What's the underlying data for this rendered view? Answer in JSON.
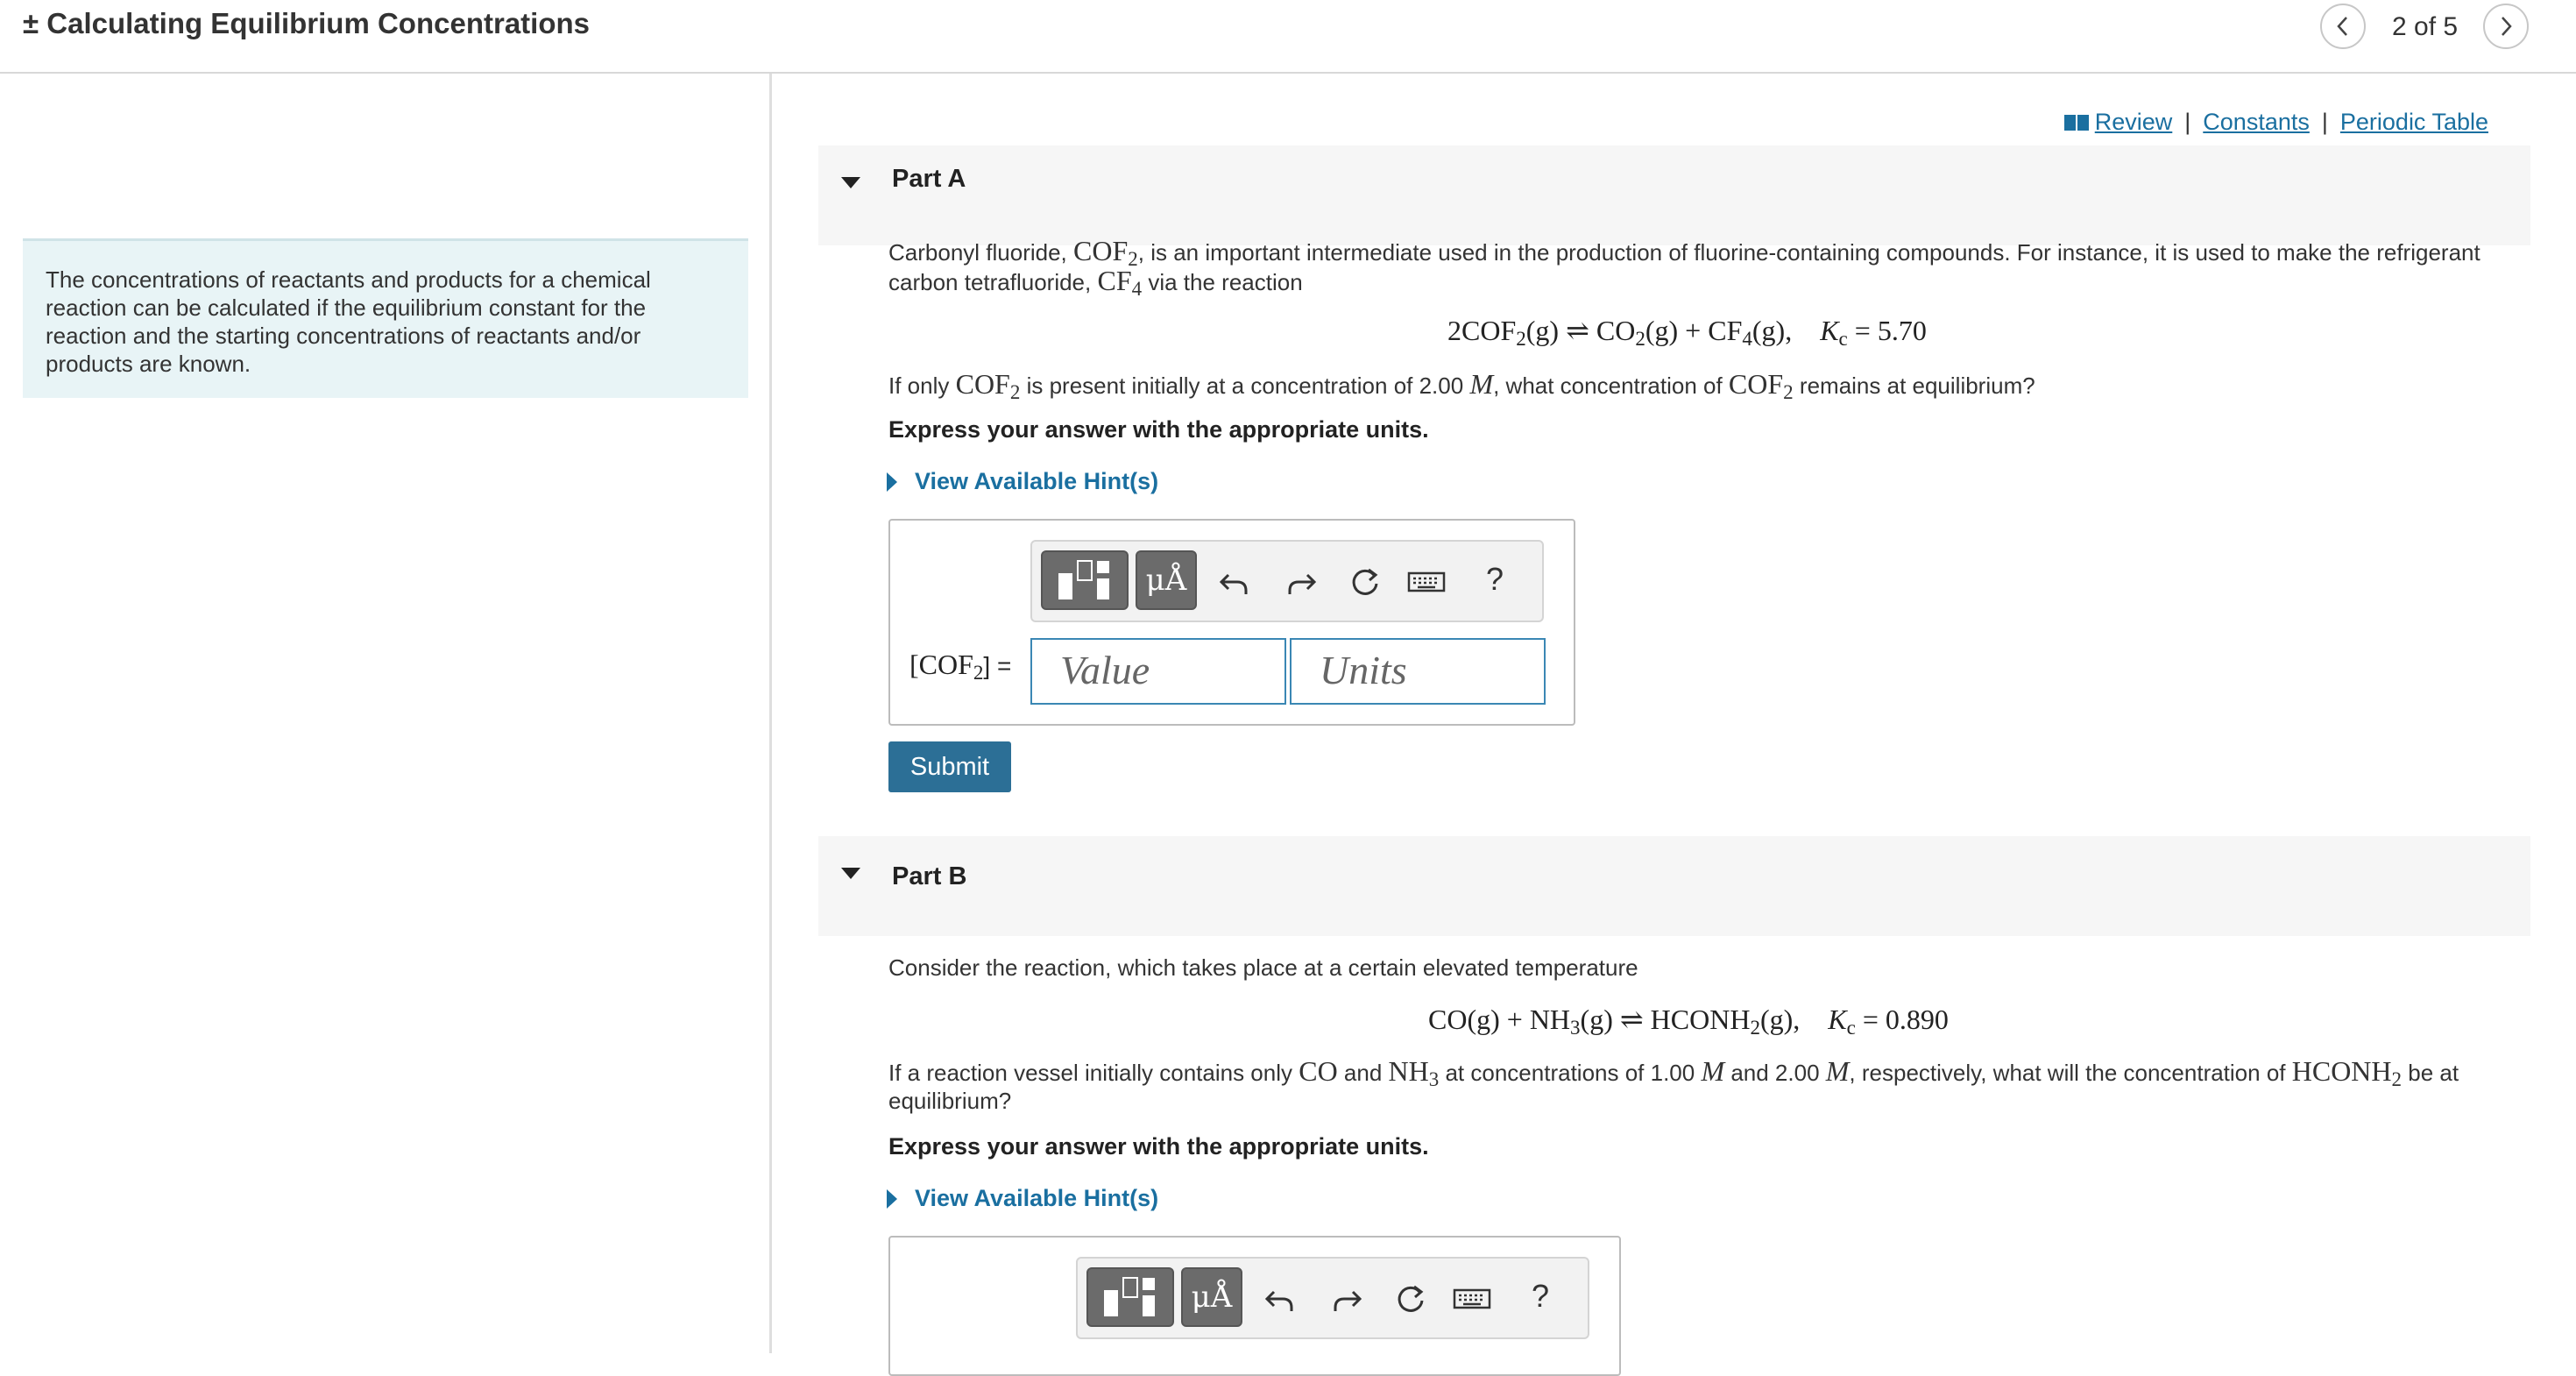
{
  "header": {
    "title": "± Calculating Equilibrium Concentrations",
    "pager": "2 of 5"
  },
  "intro": {
    "text": "The concentrations of reactants and products for a chemical reaction can be calculated if the equilibrium constant for the reaction and the starting concentrations of reactants and/or products are known."
  },
  "links": {
    "review": "Review",
    "constants": "Constants",
    "periodic_table": "Periodic Table",
    "separator": "|"
  },
  "part_a": {
    "label": "Part A",
    "intro_1": "Carbonyl fluoride, ",
    "cof2": "COF",
    "intro_2": ", is an important intermediate used in the production of fluorine-containing compounds. For instance, it is used to make the refrigerant carbon tetrafluoride, ",
    "cf4": "CF",
    "intro_3": " via the reaction",
    "equation": {
      "reactant": "2COF",
      "phase": "(g)",
      "arrow": "⇌",
      "prod1": "CO",
      "prod2": "CF",
      "plus": "+",
      "kc_label": "K",
      "kc_sub": "c",
      "kc_value": "= 5.70"
    },
    "question_1": "If only ",
    "question_2": " is present initially at a concentration of 2.00 ",
    "unit_m": "M",
    "question_3": ", what concentration of ",
    "question_4": " remains at equilibrium?",
    "instruction": "Express your answer with the appropriate units.",
    "hint_label": "View Available Hint(s)",
    "answer_label": "[COF",
    "answer_label_end": "] =",
    "value_placeholder": "Value",
    "units_placeholder": "Units",
    "submit_label": "Submit"
  },
  "part_b": {
    "label": "Part B",
    "intro": "Consider the reaction, which takes place at a certain elevated temperature",
    "equation": {
      "co": "CO",
      "nh3": "NH",
      "hconh2": "HCONH",
      "phase": "(g)",
      "plus": "+",
      "arrow": "⇌",
      "kc_label": "K",
      "kc_sub": "c",
      "kc_value": "= 0.890"
    },
    "question_1": "If a reaction vessel initially contains only ",
    "question_2": " and ",
    "question_3": " at concentrations of 1.00 ",
    "question_4": " and 2.00 ",
    "question_5": ", respectively, what will the concentration of ",
    "question_6": " be at equilibrium?",
    "instruction": "Express your answer with the appropriate units.",
    "hint_label": "View Available Hint(s)"
  },
  "toolbar": {
    "mu_label": "μÅ",
    "help_label": "?"
  },
  "sub_2": "2",
  "sub_3": "3",
  "sub_4": "4"
}
